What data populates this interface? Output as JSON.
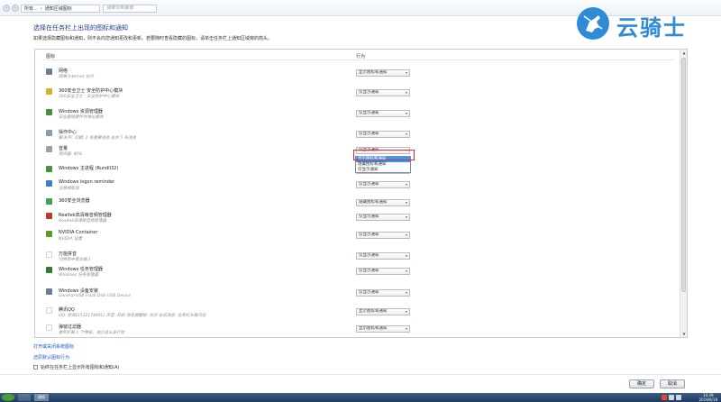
{
  "window": {
    "breadcrumb": [
      "所有...",
      "通知区域图标"
    ],
    "search_placeholder": "搜索控制面板"
  },
  "watermark": {
    "text": "云骑士"
  },
  "header": {
    "title": "选择在任务栏上出现的图标和通知",
    "description": "如果选择隐藏图标和通知，则不会向您通知更改和更新。若要随时查看隐藏的图标，请单击任务栏上通知区域旁的箭头。"
  },
  "columns": {
    "icon": "图标",
    "behavior": "行为"
  },
  "rows": [
    {
      "name": "网络",
      "sub": "网络 Internet 访问",
      "behavior": "显示图标和通知",
      "icon": "network-icon",
      "color": "#6b7d93"
    },
    {
      "name": "360安全卫士 安全防护中心模块",
      "sub": "360安全卫士 - 安全防护中心模块",
      "behavior": "仅显示通知",
      "icon": "360-shield-icon",
      "color": "#d8b21c"
    },
    {
      "name": "Windows 资源管理器",
      "sub": "安全删除硬件并弹出媒体",
      "behavior": "仅显示通知",
      "icon": "usb-eject-icon",
      "color": "#4a8f3f"
    },
    {
      "name": "操作中心",
      "sub": "解决 PC 问题: 2 条重要消息 总共 5 条消息",
      "behavior": "仅显示通知",
      "icon": "flag-icon",
      "color": "#8c9bb0"
    },
    {
      "name": "音量",
      "sub": "扬声器: 40%",
      "behavior": "仅显示通知",
      "icon": "speaker-icon",
      "color": "#9aa3ad"
    },
    {
      "name": "Windows 主进程 (Rundll32)",
      "sub": "",
      "behavior": "仅显示通知",
      "icon": "rundll-icon",
      "color": "#4a8f3f"
    },
    {
      "name": "Windows logon reminder",
      "sub": "注销或取消",
      "behavior": "仅显示通知",
      "icon": "logon-icon",
      "color": "#3a7fc8"
    },
    {
      "name": "360安全浏览器",
      "sub": "",
      "behavior": "隐藏图标和通知",
      "icon": "360-browser-icon",
      "color": "#3aa655"
    },
    {
      "name": "Realtek高清晰音频管理器",
      "sub": "Realtek高清晰音频管理器",
      "behavior": "仅显示通知",
      "icon": "realtek-audio-icon",
      "color": "#c0392b"
    },
    {
      "name": "NVIDIA Container",
      "sub": "NVIDIA 设置",
      "behavior": "仅显示通知",
      "icon": "nvidia-icon",
      "color": "#5a9d22"
    },
    {
      "name": "万能拼音",
      "sub": "切换到中英文输入",
      "behavior": "仅显示通知",
      "icon": "ime-icon",
      "color": "#ffffff"
    },
    {
      "name": "Windows 任务管理器",
      "sub": "Windows 任务管理器",
      "behavior": "仅显示通知",
      "icon": "task-manager-icon",
      "color": "#2e7d32"
    },
    {
      "name": "Windows 设备安装",
      "sub": "General USB Flash Disk USB Device",
      "behavior": "仅显示通知",
      "icon": "device-install-icon",
      "color": "#6b7d93"
    },
    {
      "name": "腾讯QQ",
      "sub": "QQ: 欧阳(1532174491) 声音: 开启 消息提醒框: 关闭 会话消息: 任务栏头像闪动",
      "behavior": "显示图标和通知",
      "icon": "qq-icon",
      "color": "#ffffff"
    },
    {
      "name": "弹窗过滤器",
      "sub": "累积拦截 1 个弹窗，减少这么多打扰",
      "behavior": "显示图标和通知",
      "icon": "popup-filter-icon",
      "color": "#ffffff"
    }
  ],
  "dropdown": {
    "options": [
      "显示图标和通知",
      "隐藏图标和通知",
      "仅显示通知"
    ],
    "highlighted": 0
  },
  "links": {
    "toggle_system_icons": "打开或关闭系统图标",
    "restore_defaults": "还原默认图标行为"
  },
  "checkbox": {
    "label": "始终在任务栏上显示所有图标和通知(A)"
  },
  "buttons": {
    "ok": "确定",
    "cancel": "取消"
  },
  "taskbar": {
    "active_label": "通知",
    "clock_time": "14:39",
    "clock_date": "2019/6/18"
  }
}
